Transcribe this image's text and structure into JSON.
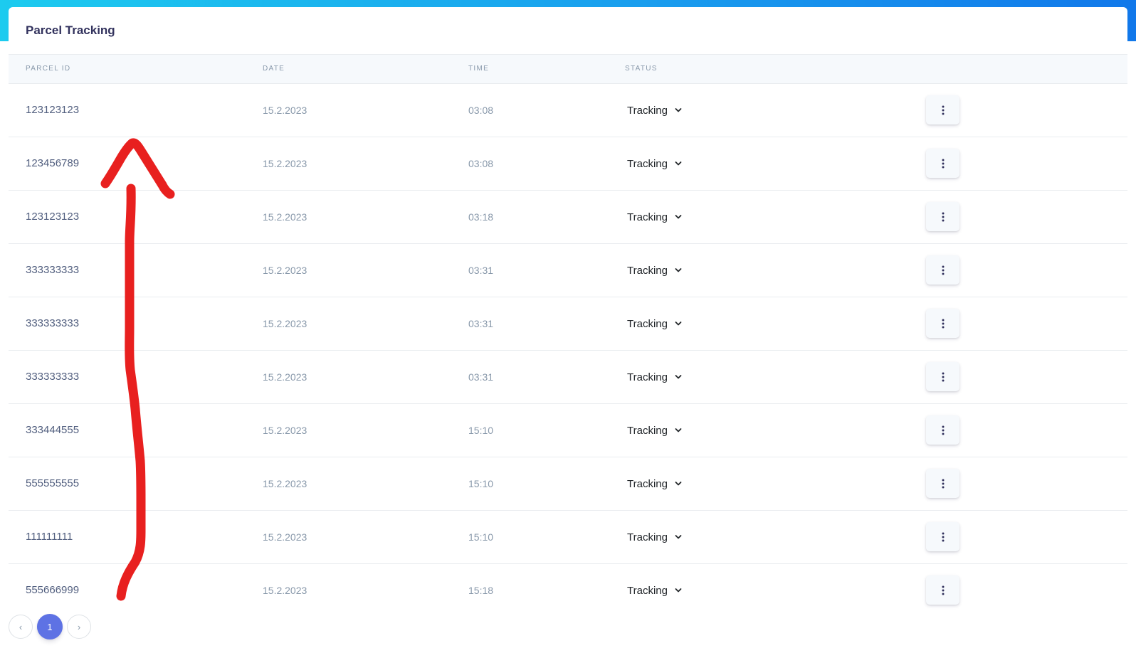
{
  "card": {
    "title": "Parcel Tracking"
  },
  "table": {
    "headers": {
      "parcel_id": "PARCEL ID",
      "date": "DATE",
      "time": "TIME",
      "status": "STATUS"
    },
    "rows": [
      {
        "parcel_id": "123123123",
        "date": "15.2.2023",
        "time": "03:08",
        "status": "Tracking"
      },
      {
        "parcel_id": "123456789",
        "date": "15.2.2023",
        "time": "03:08",
        "status": "Tracking"
      },
      {
        "parcel_id": "123123123",
        "date": "15.2.2023",
        "time": "03:18",
        "status": "Tracking"
      },
      {
        "parcel_id": "333333333",
        "date": "15.2.2023",
        "time": "03:31",
        "status": "Tracking"
      },
      {
        "parcel_id": "333333333",
        "date": "15.2.2023",
        "time": "03:31",
        "status": "Tracking"
      },
      {
        "parcel_id": "333333333",
        "date": "15.2.2023",
        "time": "03:31",
        "status": "Tracking"
      },
      {
        "parcel_id": "333444555",
        "date": "15.2.2023",
        "time": "15:10",
        "status": "Tracking"
      },
      {
        "parcel_id": "555555555",
        "date": "15.2.2023",
        "time": "15:10",
        "status": "Tracking"
      },
      {
        "parcel_id": "111111111",
        "date": "15.2.2023",
        "time": "15:10",
        "status": "Tracking"
      },
      {
        "parcel_id": "555666999",
        "date": "15.2.2023",
        "time": "15:18",
        "status": "Tracking"
      }
    ]
  },
  "pagination": {
    "prev": "‹",
    "current": "1",
    "next": "›"
  },
  "icons": {
    "status_dropdown": "chevron-down-icon",
    "row_actions": "kebab-menu-icon"
  },
  "colors": {
    "header_gradient_start": "#1ccbef",
    "header_gradient_end": "#1178ea",
    "pager_active": "#5e72e4",
    "annotation_stroke": "#e8201f"
  }
}
